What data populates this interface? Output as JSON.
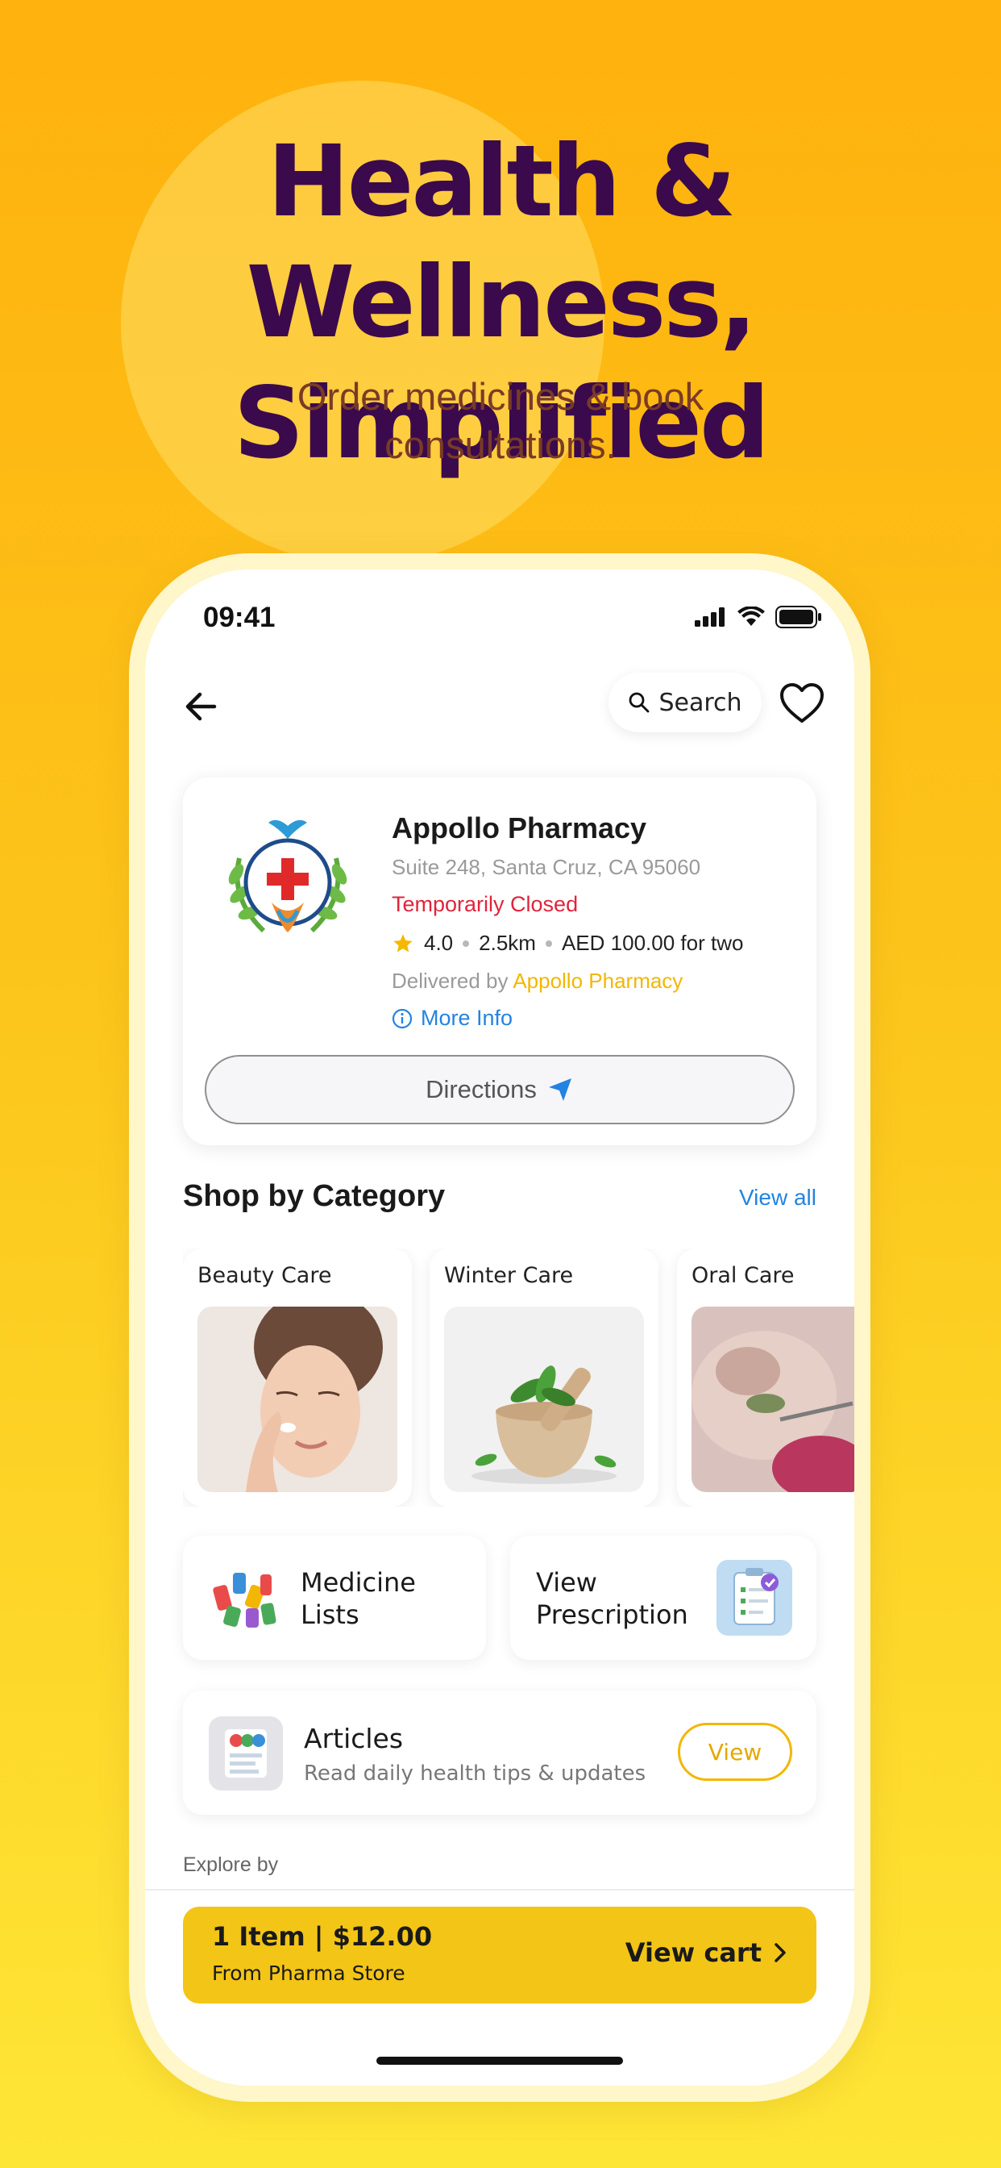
{
  "promo": {
    "headline_line1": "Health & Wellness,",
    "headline_line2": "Simplified",
    "subline_line1": "Order medicines & book",
    "subline_line2": "consultations."
  },
  "status_bar": {
    "time": "09:41"
  },
  "nav": {
    "search_label": "Search"
  },
  "store": {
    "name": "Appollo Pharmacy",
    "address": "Suite 248, Santa Cruz, CA 95060",
    "status": "Temporarily Closed",
    "rating": "4.0",
    "distance": "2.5km",
    "price_for_two": "AED 100.00 for two",
    "delivered_prefix": "Delivered by",
    "delivered_by": "Appollo Pharmacy",
    "more_info": "More Info",
    "directions": "Directions"
  },
  "categories": {
    "title": "Shop by Category",
    "view_all": "View all",
    "items": [
      {
        "label": "Beauty Care"
      },
      {
        "label": "Winter Care"
      },
      {
        "label": "Oral Care"
      }
    ]
  },
  "tiles": {
    "medicine_line1": "Medicine",
    "medicine_line2": "Lists",
    "prescription_line1": "View",
    "prescription_line2": "Prescription"
  },
  "articles": {
    "title": "Articles",
    "subtitle": "Read daily health tips & updates",
    "button": "View"
  },
  "explore_label": "Explore by",
  "cart": {
    "items": "1 Item | $12.00",
    "from": "From Pharma Store",
    "view_cart": "View cart"
  },
  "colors": {
    "headline": "#3A0A4D",
    "accent_yellow": "#F3C516",
    "link_blue": "#2383E2",
    "closed_red": "#E0243C"
  }
}
